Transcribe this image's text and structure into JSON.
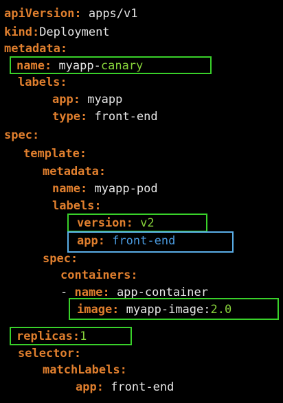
{
  "yaml": {
    "l1_key": "apiVersion:",
    "l1_val": "apps/v1",
    "l2_key": "kind:",
    "l2_val": "Deployment",
    "l3_key": "metadata:",
    "l4_key": "name:",
    "l4_val_a": "myapp-",
    "l4_val_b": "canary",
    "l5_key": "labels:",
    "l6_key": "app:",
    "l6_val": "myapp",
    "l7_key": "type:",
    "l7_val": "front-end",
    "l8_key": "spec:",
    "l9_key": "template:",
    "l10_key": "metadata:",
    "l11_key": "name:",
    "l11_val": "myapp-pod",
    "l12_key": "labels:",
    "l13_key": "version:",
    "l13_val": "v2",
    "l14_key": "app:",
    "l14_val": "front-end",
    "l15_key": "spec:",
    "l16_key": "containers:",
    "l17_dash": "-",
    "l17_key": "name:",
    "l17_val": "app-container",
    "l18_key": "image:",
    "l18_val_a": "myapp-image:",
    "l18_val_b": "2.0",
    "l19_key": "replicas:",
    "l19_val": "1",
    "l20_key": "selector:",
    "l21_key": "matchLabels:",
    "l22_key": "app:",
    "l22_val": "front-end"
  },
  "colors": {
    "key": "#e07f2e",
    "value": "#e8e8e8",
    "highlight_green": "#86d13a",
    "highlight_blue": "#4a9be0",
    "box_green": "#39d12a",
    "box_blue": "#5aaee8",
    "background": "#000000"
  }
}
